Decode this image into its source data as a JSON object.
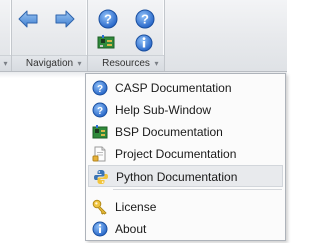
{
  "ribbon": {
    "groups": [
      {
        "label": "Navigation"
      },
      {
        "label": "Resources"
      }
    ]
  },
  "menu": {
    "items": [
      {
        "label": "CASP Documentation",
        "icon": "help-circle-icon"
      },
      {
        "label": "Help Sub-Window",
        "icon": "help-circle-icon"
      },
      {
        "label": "BSP Documentation",
        "icon": "circuit-board-icon"
      },
      {
        "label": "Project Documentation",
        "icon": "document-icon"
      },
      {
        "label": "Python Documentation",
        "icon": "python-icon",
        "selected": true
      },
      {
        "label": "License",
        "icon": "key-icon"
      },
      {
        "label": "About",
        "icon": "info-icon"
      }
    ]
  },
  "colors": {
    "help_blue": "#2f6fcf",
    "arrow_blue": "#4a88d8",
    "menu_selected": "#e8eaed"
  }
}
